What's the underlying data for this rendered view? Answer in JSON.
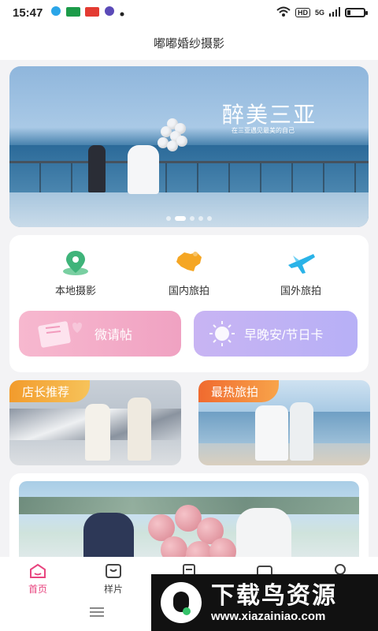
{
  "status_bar": {
    "time": "15:47",
    "network": "HD",
    "signal_text": "5G",
    "battery_level": 0.2
  },
  "header": {
    "title": "嘟嘟婚纱摄影"
  },
  "banner": {
    "title": "醉美三亚",
    "subtitle": "在三亚遇见最美的自己",
    "slide_count": 5,
    "active_slide": 1
  },
  "services": [
    {
      "label": "本地摄影",
      "icon": "map-pin-icon",
      "color": "#3fb47a"
    },
    {
      "label": "国内旅拍",
      "icon": "china-map-icon",
      "color": "#f5a623"
    },
    {
      "label": "国外旅拍",
      "icon": "airplane-icon",
      "color": "#2ab3e8"
    }
  ],
  "cards": {
    "invitation": "微请帖",
    "greeting_card": "早晚安/节日卡"
  },
  "promos": {
    "left_tag": "店长推荐",
    "right_tag": "最热旅拍"
  },
  "bottom_nav": {
    "tabs": [
      {
        "label": "首页",
        "icon": "home-icon",
        "active": true
      },
      {
        "label": "样片",
        "icon": "bag-icon",
        "active": false
      },
      {
        "label": "",
        "icon": "doc-icon",
        "active": false
      },
      {
        "label": "",
        "icon": "camera-icon",
        "active": false
      },
      {
        "label": "",
        "icon": "profile-icon",
        "active": false
      }
    ]
  },
  "watermark": {
    "title": "下载鸟资源",
    "url": "www.xiazainiao.com"
  },
  "colors": {
    "accent": "#e8457f",
    "invitation_bg": "#f4aac8",
    "greeting_bg": "#c0b3f4"
  }
}
